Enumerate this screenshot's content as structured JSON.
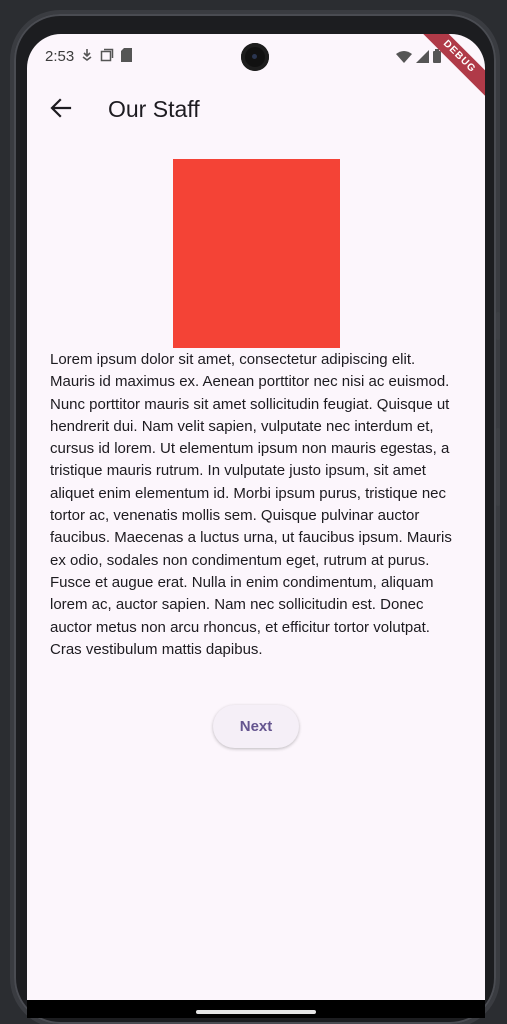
{
  "status_bar": {
    "time": "2:53",
    "left_icons": [
      "download-icon",
      "screenshot-icon",
      "sd-card-icon"
    ],
    "right_icons": [
      "wifi-icon",
      "cellular-icon",
      "battery-icon"
    ]
  },
  "debug_banner": "DEBUG",
  "app_bar": {
    "back_icon": "arrow-back-icon",
    "title": "Our Staff"
  },
  "content": {
    "image_color": "#f44336",
    "paragraph": "Lorem ipsum dolor sit amet, consectetur adipiscing elit. Mauris id maximus ex. Aenean porttitor nec nisi ac euismod. Nunc porttitor mauris sit amet sollicitudin feugiat. Quisque ut hendrerit dui. Nam velit sapien, vulputate nec interdum et, cursus id lorem. Ut elementum ipsum non mauris egestas, a tristique mauris rutrum. In vulputate justo ipsum, sit amet aliquet enim elementum id. Morbi ipsum purus, tristique nec tortor ac, venenatis mollis sem. Quisque pulvinar auctor faucibus. Maecenas a luctus urna, ut faucibus ipsum. Mauris ex odio, sodales non condimentum eget, rutrum at purus. Fusce et augue erat. Nulla in enim condimentum, aliquam lorem ac, auctor sapien. Nam nec sollicitudin est. Donec auctor metus non arcu rhoncus, et efficitur tortor volutpat. Cras vestibulum mattis dapibus.",
    "next_label": "Next"
  },
  "colors": {
    "background": "#fcf6fc",
    "accent": "#65558f",
    "text": "#1d1b20"
  }
}
